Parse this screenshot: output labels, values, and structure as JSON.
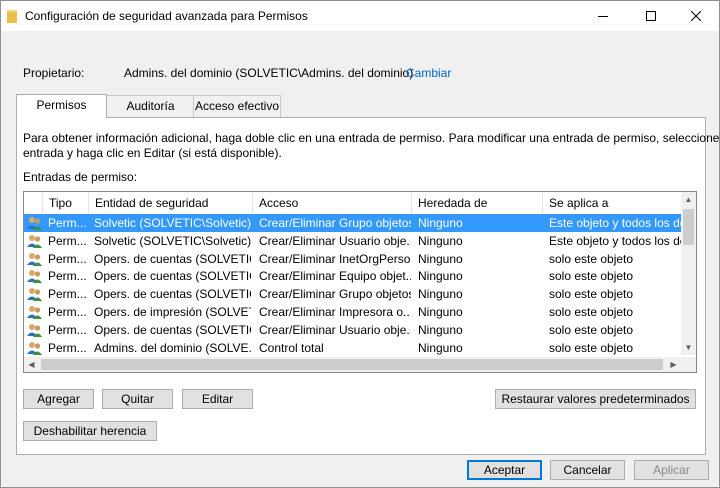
{
  "window": {
    "title": "Configuración de seguridad avanzada para Permisos"
  },
  "owner": {
    "label": "Propietario:",
    "value": "Admins. del dominio (SOLVETIC\\Admins. del dominio)",
    "change_link": "Cambiar"
  },
  "tabs": [
    {
      "label": "Permisos",
      "active": true
    },
    {
      "label": "Auditoría",
      "active": false
    },
    {
      "label": "Acceso efectivo",
      "active": false
    }
  ],
  "info": {
    "line1": "Para obtener información adicional, haga doble clic en una entrada de permiso. Para modificar una entrada de permiso, seleccione la",
    "line2": "entrada y haga clic en Editar (si está disponible).",
    "entries_label": "Entradas de permiso:"
  },
  "grid": {
    "columns": [
      "Tipo",
      "Entidad de seguridad",
      "Acceso",
      "Heredada de",
      "Se aplica a"
    ],
    "rows": [
      {
        "tipo": "Perm...",
        "entidad": "Solvetic (SOLVETIC\\Solvetic)",
        "acceso": "Crear/Eliminar Grupo objetos",
        "heredada": "Ninguno",
        "aplica": "Este objeto y todos los desc...",
        "selected": true
      },
      {
        "tipo": "Perm...",
        "entidad": "Solvetic (SOLVETIC\\Solvetic)",
        "acceso": "Crear/Eliminar Usuario obje...",
        "heredada": "Ninguno",
        "aplica": "Este objeto y todos los desc...",
        "selected": false
      },
      {
        "tipo": "Perm...",
        "entidad": "Opers. de cuentas (SOLVETIC...",
        "acceso": "Crear/Eliminar InetOrgPerso...",
        "heredada": "Ninguno",
        "aplica": "solo este objeto",
        "selected": false
      },
      {
        "tipo": "Perm...",
        "entidad": "Opers. de cuentas (SOLVETIC...",
        "acceso": "Crear/Eliminar Equipo objet...",
        "heredada": "Ninguno",
        "aplica": "solo este objeto",
        "selected": false
      },
      {
        "tipo": "Perm...",
        "entidad": "Opers. de cuentas (SOLVETIC...",
        "acceso": "Crear/Eliminar Grupo objetos",
        "heredada": "Ninguno",
        "aplica": "solo este objeto",
        "selected": false
      },
      {
        "tipo": "Perm...",
        "entidad": "Opers. de impresión (SOLVET...",
        "acceso": "Crear/Eliminar Impresora o...",
        "heredada": "Ninguno",
        "aplica": "solo este objeto",
        "selected": false
      },
      {
        "tipo": "Perm...",
        "entidad": "Opers. de cuentas (SOLVETIC...",
        "acceso": "Crear/Eliminar Usuario obje...",
        "heredada": "Ninguno",
        "aplica": "solo este objeto",
        "selected": false
      },
      {
        "tipo": "Perm...",
        "entidad": "Admins. del dominio (SOLVE...",
        "acceso": "Control total",
        "heredada": "Ninguno",
        "aplica": "solo este objeto",
        "selected": false
      }
    ]
  },
  "buttons": {
    "agregar": "Agregar",
    "quitar": "Quitar",
    "editar": "Editar",
    "restaurar": "Restaurar valores predeterminados",
    "deshabilitar": "Deshabilitar herencia",
    "aceptar": "Aceptar",
    "cancelar": "Cancelar",
    "aplicar": "Aplicar"
  },
  "colors": {
    "selection": "#3399ff",
    "link": "#0066cc",
    "default_button_border": "#0078d7"
  },
  "icons": {
    "title": "folder-icon",
    "row": "users-group-icon",
    "minimize": "minimize-icon",
    "maximize": "maximize-icon",
    "close": "close-icon"
  }
}
